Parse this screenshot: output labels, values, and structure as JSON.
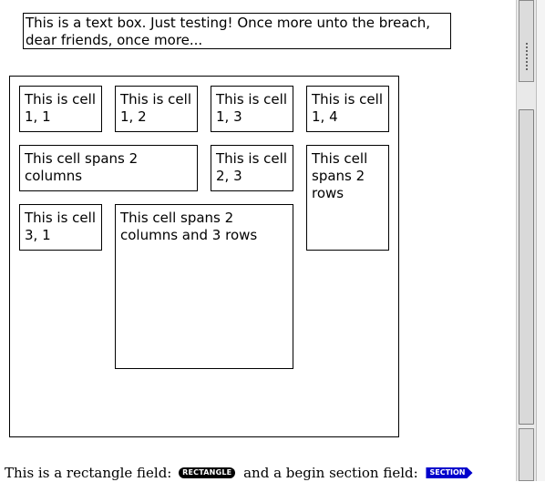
{
  "text_box": {
    "text": "This is a text box. Just testing! Once more unto the breach, dear friends, once more..."
  },
  "table": {
    "cells": [
      {
        "text": "This is cell 1, 1"
      },
      {
        "text": "This is cell 1, 2"
      },
      {
        "text": "This is cell 1, 3"
      },
      {
        "text": "This is cell 1, 4"
      },
      {
        "text": "This cell spans 2 columns"
      },
      {
        "text": "This is cell 2, 3"
      },
      {
        "text": "This cell spans 2 rows"
      },
      {
        "text": "This is cell 3, 1"
      },
      {
        "text": "This cell spans 2 columns and 3 rows"
      }
    ]
  },
  "footer": {
    "prefix": "This is a rectangle field:",
    "rectangle_field_label": "RECTANGLE",
    "middle": "and a begin section field:",
    "section_field_label": "SECTION"
  },
  "colors": {
    "rectangle_field_bg": "#000000",
    "section_field_bg": "#0000cc"
  }
}
